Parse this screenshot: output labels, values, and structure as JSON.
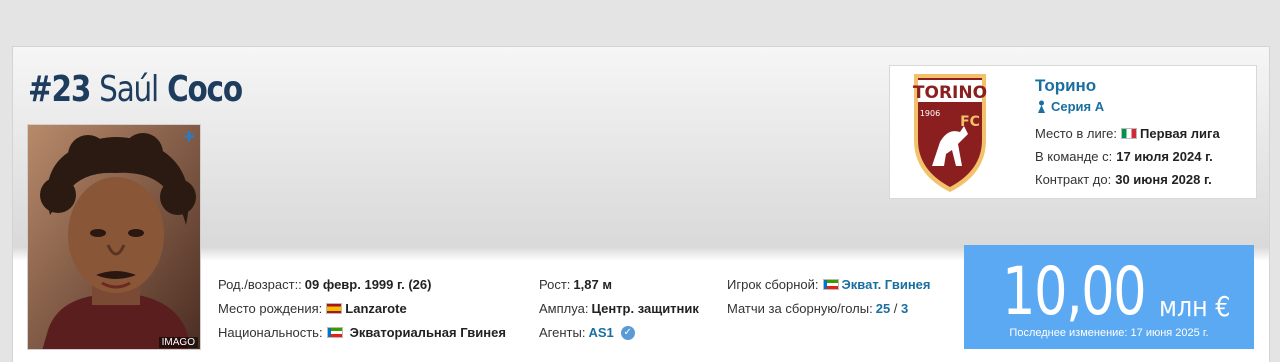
{
  "player": {
    "number": "#23",
    "first_name": "Saúl",
    "last_name": "Coco",
    "photo_credit": "IMAGO"
  },
  "club": {
    "name": "Торино",
    "crest_text": "TORINO",
    "crest_year": "1906",
    "crest_fc": "FC",
    "league": "Серия А",
    "league_level_label": "Место в лиге:",
    "league_level_value": "Первая лига",
    "joined_label": "В команде с:",
    "joined_value": "17 июля 2024 г.",
    "contract_label": "Контракт до:",
    "contract_value": "30 июня 2028 г."
  },
  "info": {
    "dob_label": "Род./возраст::",
    "dob_value": "09 февр. 1999 г. (26)",
    "birthplace_label": "Место рождения:",
    "birthplace_value": "Lanzarote",
    "nationality_label": "Национальность:",
    "nationality_value": "Экваториальная Гвинея",
    "height_label": "Рост:",
    "height_value": "1,87 м",
    "position_label": "Амплуа:",
    "position_value": "Центр. защитник",
    "agent_label": "Агенты:",
    "agent_value": "AS1",
    "intl_label": "Игрок сборной:",
    "intl_value": "Экват. Гвинея",
    "caps_label": "Матчи за сборную/голы:",
    "caps_value": "25",
    "caps_sep": " / ",
    "goals_value": "3"
  },
  "market_value": {
    "value": "10,00",
    "unit": "млн €",
    "last_change": "Последнее изменение: 17 июня 2025 г."
  },
  "icons": {
    "plus": "plus-icon",
    "verified": "verified-check-icon",
    "serie_a": "serie-a-logo-icon",
    "flag_italy": "italy-flag-icon",
    "flag_spain": "spain-flag-icon",
    "flag_eq_guinea": "equatorial-guinea-flag-icon"
  }
}
